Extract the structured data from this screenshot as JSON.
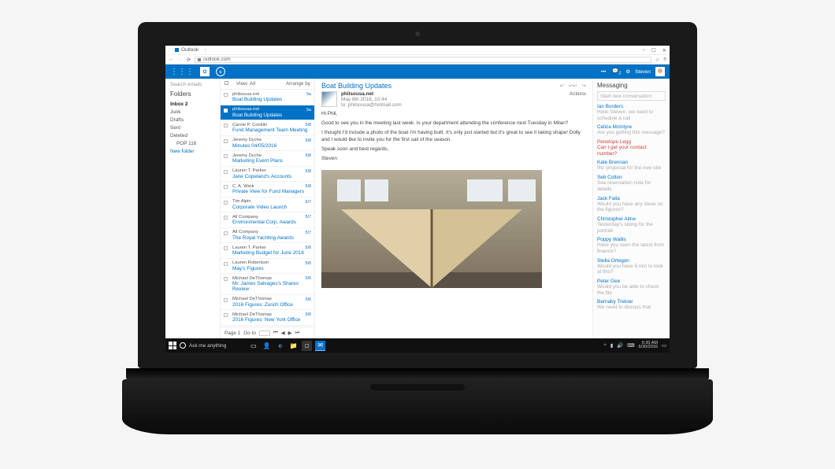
{
  "browser": {
    "tab_title": "Outlook",
    "url": "outlook.com",
    "win_buttons": [
      "–",
      "☐",
      "✕"
    ]
  },
  "appbar": {
    "logo": "O",
    "user_name": "Steven",
    "chat_badge": "2",
    "notif_badge": "•"
  },
  "folders": {
    "search_placeholder": "Search emails",
    "title": "Folders",
    "items": [
      {
        "label": "Inbox",
        "count": "2",
        "selected": true
      },
      {
        "label": "Junk"
      },
      {
        "label": "Drafts"
      },
      {
        "label": "Sent"
      },
      {
        "label": "Deleted"
      },
      {
        "label": "POP",
        "count": "116",
        "indent": true
      },
      {
        "label": "New folder",
        "link": true
      }
    ]
  },
  "msglist": {
    "view_label": "View: All",
    "arrange_label": "Arrange by",
    "messages": [
      {
        "from": "philsousa.net",
        "subject": "Boat Building Updates",
        "date": "5a"
      },
      {
        "from": "philsousa.net",
        "subject": "Boat Building Updates",
        "date": "5a",
        "selected": true
      },
      {
        "from": "Carole P. Conklin",
        "subject": "Fund Management Team Meeting",
        "date": "5/8"
      },
      {
        "from": "Jeremy Dyche",
        "subject": "Minutes 04/05/2016",
        "date": "5/8"
      },
      {
        "from": "Jeremy Dyche",
        "subject": "Marketing Event Plans",
        "date": "5/8"
      },
      {
        "from": "Lauren T. Parker",
        "subject": "Jane Copeland's Accounts",
        "date": "5/8"
      },
      {
        "from": "C. A. Wark",
        "subject": "Private View for Fund Managers",
        "date": "5/8"
      },
      {
        "from": "Tim Alpin",
        "subject": "Corporate Video Launch",
        "date": "5/7"
      },
      {
        "from": "All Company",
        "subject": "Environmental Corp. Awards",
        "date": "5/7"
      },
      {
        "from": "All Company",
        "subject": "The Royal Yachting Awards",
        "date": "5/7"
      },
      {
        "from": "Lauren T. Parker",
        "subject": "Marketing Budget for June 2016",
        "date": "5/6"
      },
      {
        "from": "Lauren Robertson",
        "subject": "May's Figures",
        "date": "5/6"
      },
      {
        "from": "Michael DeThomas",
        "subject": "Mr. James Salvages's Shares Review",
        "date": "5/6"
      },
      {
        "from": "Michael DeThomas",
        "subject": "2016 Figures: Zurich Office",
        "date": "5/6"
      },
      {
        "from": "Michael DeThomas",
        "subject": "2016 Figures: New York Office",
        "date": "5/6"
      }
    ],
    "page_label": "Page 1",
    "goto_label": "Go to"
  },
  "reading": {
    "subject": "Boat Building Updates",
    "sender_name": "philsousa.net",
    "sent_date": "May 8th 2016, 10:44",
    "sender_email": "to: philsousa@hotmail.com",
    "actions_label": "Actions",
    "greeting": "Hi Phil,",
    "p1": "Good to see you in the meeting last week. Is your department attending the conference next Tuesday in Milan?",
    "p2": "I thought I'd include a photo of the boat I'm having built. It's only just started but it's great to see it taking shape! Dolly and I would like to invite you for the first sail of the season.",
    "p3": "Speak soon and best regards,",
    "sig": "Steven"
  },
  "messaging": {
    "title": "Messaging",
    "new_placeholder": "Start new conversation",
    "contacts": [
      {
        "name": "Ian Borders",
        "status": "Hello Steven, we need to schedule a call"
      },
      {
        "name": "Celiza McIntyre",
        "status": "Are you getting this message?"
      },
      {
        "name": "Penelope Legg",
        "status": "Can I get your contact number?",
        "highlight": true
      },
      {
        "name": "Kate Brennan",
        "status": "Re: proposal for the new site"
      },
      {
        "name": "Seb Colton",
        "status": "See reservation note for details"
      },
      {
        "name": "Jack Falla",
        "status": "Would you have any ideas on the figures?"
      },
      {
        "name": "Christopher Aitne",
        "status": "Yesterday's sitting for the portrait"
      },
      {
        "name": "Poppy Wallis",
        "status": "Have you seen the latest from finance?"
      },
      {
        "name": "Stella Ortegon",
        "status": "Would you have 5 min to look at this?"
      },
      {
        "name": "Peter Gee",
        "status": "Would you be able to check the file"
      },
      {
        "name": "Barnaby Treloar",
        "status": "We need to discuss that"
      }
    ]
  },
  "taskbar": {
    "cortana": "Ask me anything",
    "time": "6:30 AM",
    "date": "6/30/2016"
  }
}
